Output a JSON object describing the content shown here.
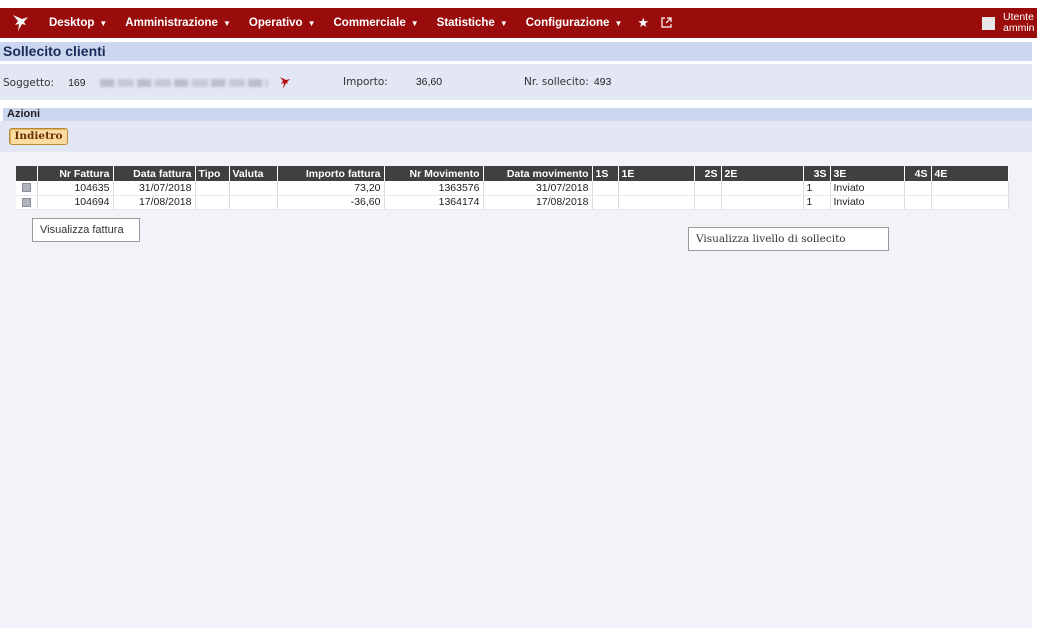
{
  "menu": {
    "items": [
      {
        "label": "Desktop"
      },
      {
        "label": "Amministrazione"
      },
      {
        "label": "Operativo"
      },
      {
        "label": "Commerciale"
      },
      {
        "label": "Statistiche"
      },
      {
        "label": "Configurazione"
      }
    ],
    "favorites_icon": "star-icon",
    "external_icon": "external-link-icon",
    "user_line1": "Utente",
    "user_line2": "ammin"
  },
  "page": {
    "title": "Sollecito clienti"
  },
  "info": {
    "soggetto_label": "Soggetto:",
    "soggetto_value": "169",
    "importo_label": "Importo:",
    "importo_value": "36,60",
    "sollecito_label": "Nr. sollecito:",
    "sollecito_value": "493"
  },
  "actions": {
    "title": "Azioni",
    "back_label": "Indietro"
  },
  "table": {
    "headers": [
      "",
      "Nr Fattura",
      "Data fattura",
      "Tipo",
      "Valuta",
      "Importo fattura",
      "Nr Movimento",
      "Data movimento",
      "1S",
      "1E",
      "2S",
      "2E",
      "3S",
      "3E",
      "4S",
      "4E"
    ],
    "rows": [
      [
        "",
        "104635",
        "31/07/2018",
        "",
        "",
        "73,20",
        "1363576",
        "31/07/2018",
        "",
        "",
        "",
        "",
        "1",
        "Inviato",
        "",
        ""
      ],
      [
        "",
        "104694",
        "17/08/2018",
        "",
        "",
        "-36,60",
        "1364174",
        "17/08/2018",
        "",
        "",
        "",
        "",
        "1",
        "Inviato",
        "",
        ""
      ]
    ]
  },
  "tooltips": {
    "fattura": "Visualizza fattura",
    "livello": "Visualizza livello di sollecito"
  },
  "colors": {
    "topbar": "#9a0b0b",
    "header_band": "#cbd6ef",
    "panel": "#e2e7f3",
    "button": "#fbdca0"
  }
}
